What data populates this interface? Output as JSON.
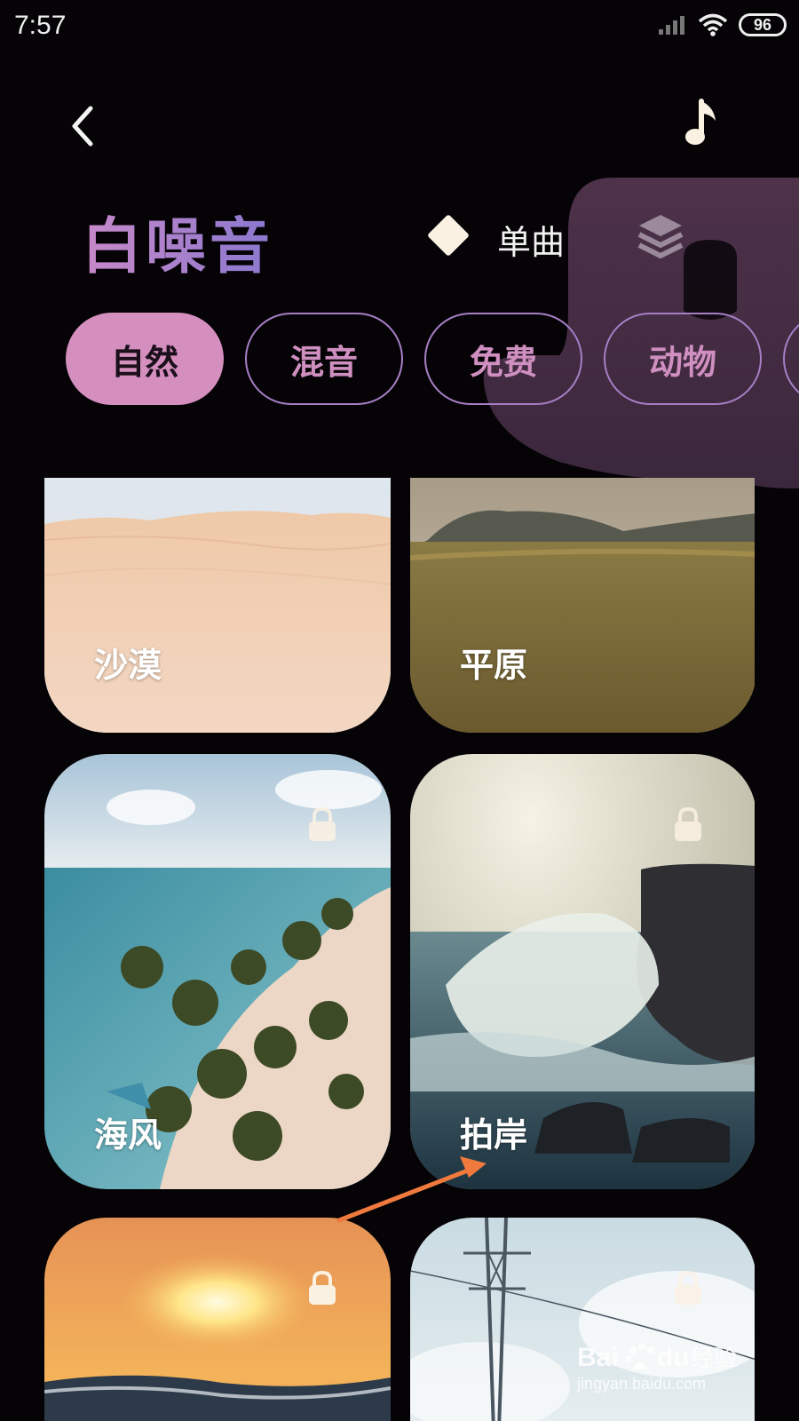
{
  "status_bar": {
    "time": "7:57",
    "battery": "96",
    "icons": [
      "signal-icon",
      "wifi-icon",
      "battery-icon"
    ]
  },
  "header": {
    "back_icon": "chevron-left-icon",
    "music_icon": "music-note-icon"
  },
  "title": "白噪音",
  "mode": {
    "icon": "diamond-icon",
    "label": "单曲",
    "layers_icon": "layers-icon"
  },
  "tabs": [
    {
      "label": "自然",
      "active": true
    },
    {
      "label": "混音",
      "active": false
    },
    {
      "label": "免费",
      "active": false
    },
    {
      "label": "动物",
      "active": false
    }
  ],
  "cards": [
    {
      "label": "沙漠",
      "locked": false
    },
    {
      "label": "平原",
      "locked": false
    },
    {
      "label": "海风",
      "locked": true
    },
    {
      "label": "拍岸",
      "locked": true
    },
    {
      "label": "",
      "locked": true
    },
    {
      "label": "",
      "locked": true
    }
  ],
  "watermark": {
    "brand": "Bai",
    "brand2": "du",
    "suffix": "经验",
    "url": "jingyan.baidu.com"
  },
  "colors": {
    "accent_pink": "#d48fbe",
    "accent_purple": "#8a78cf",
    "background": "#050306"
  }
}
